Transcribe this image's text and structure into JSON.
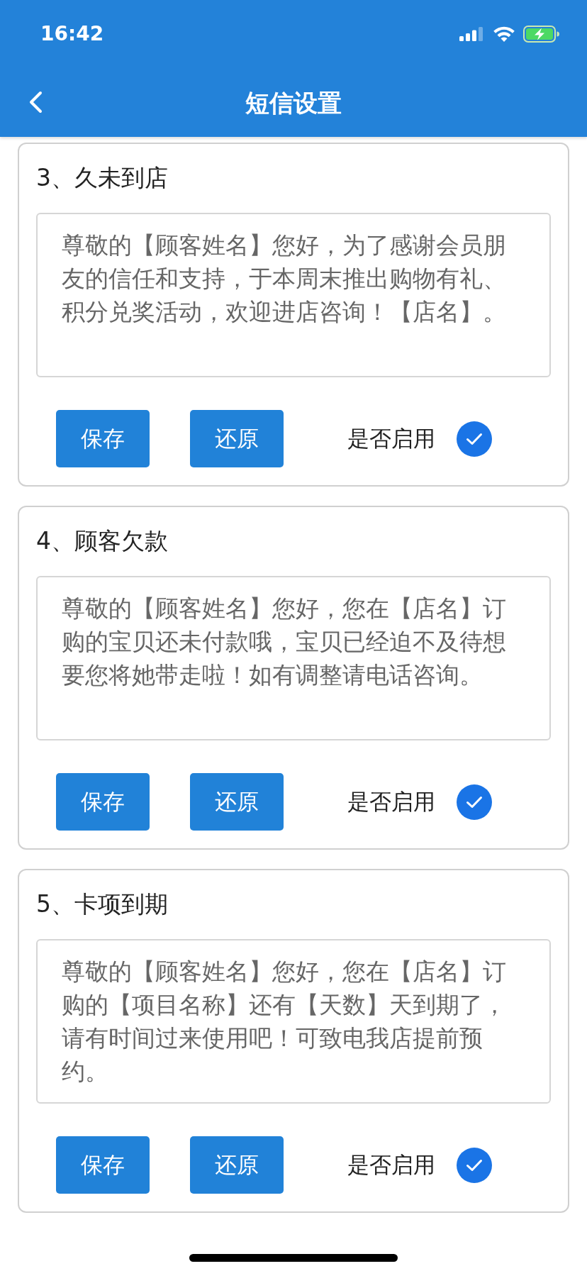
{
  "status_bar": {
    "time": "16:42"
  },
  "header": {
    "title": "短信设置"
  },
  "templates": [
    {
      "title": "3、久未到店",
      "message": "尊敬的【顾客姓名】您好，为了感谢会员朋友的信任和支持，于本周末推出购物有礼、积分兑奖活动，欢迎进店咨询！【店名】。",
      "buttons": [
        "保存",
        "还原"
      ],
      "enable_label": "是否启用",
      "enabled": true
    },
    {
      "title": "4、顾客欠款",
      "message": "尊敬的【顾客姓名】您好，您在【店名】订购的宝贝还未付款哦，宝贝已经迫不及待想要您将她带走啦！如有调整请电话咨询。",
      "buttons": [
        "保存",
        "还原"
      ],
      "enable_label": "是否启用",
      "enabled": true
    },
    {
      "title": "5、卡项到期",
      "message": "尊敬的【顾客姓名】您好，您在【店名】订购的【项目名称】还有【天数】天到期了，请有时间过来使用吧！可致电我店提前预约。",
      "buttons": [
        "保存",
        "还原"
      ],
      "enable_label": "是否启用",
      "enabled": true
    }
  ]
}
